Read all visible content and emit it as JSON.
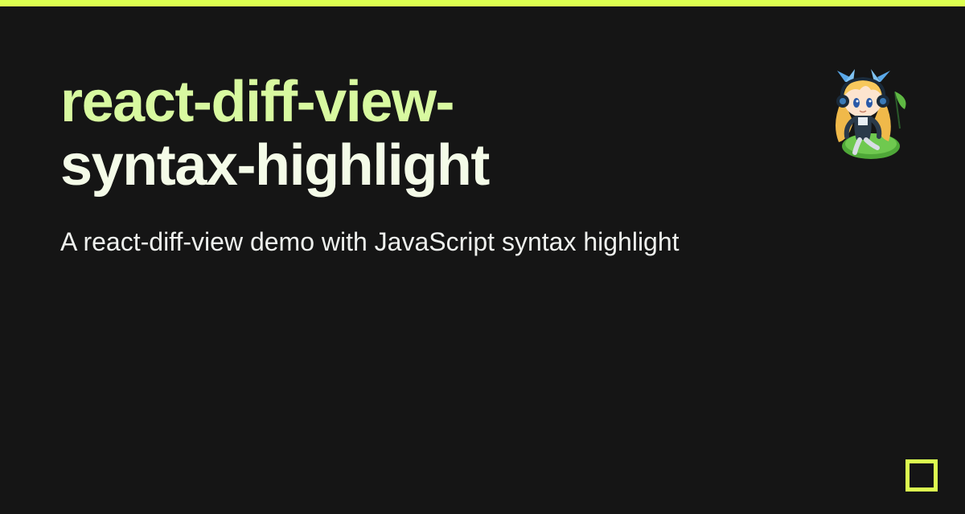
{
  "title": {
    "line1": "react-diff-view-",
    "line2": "syntax-highlight"
  },
  "subtitle": "A react-diff-view demo with JavaScript syntax highlight",
  "accent_color": "#dcff50"
}
